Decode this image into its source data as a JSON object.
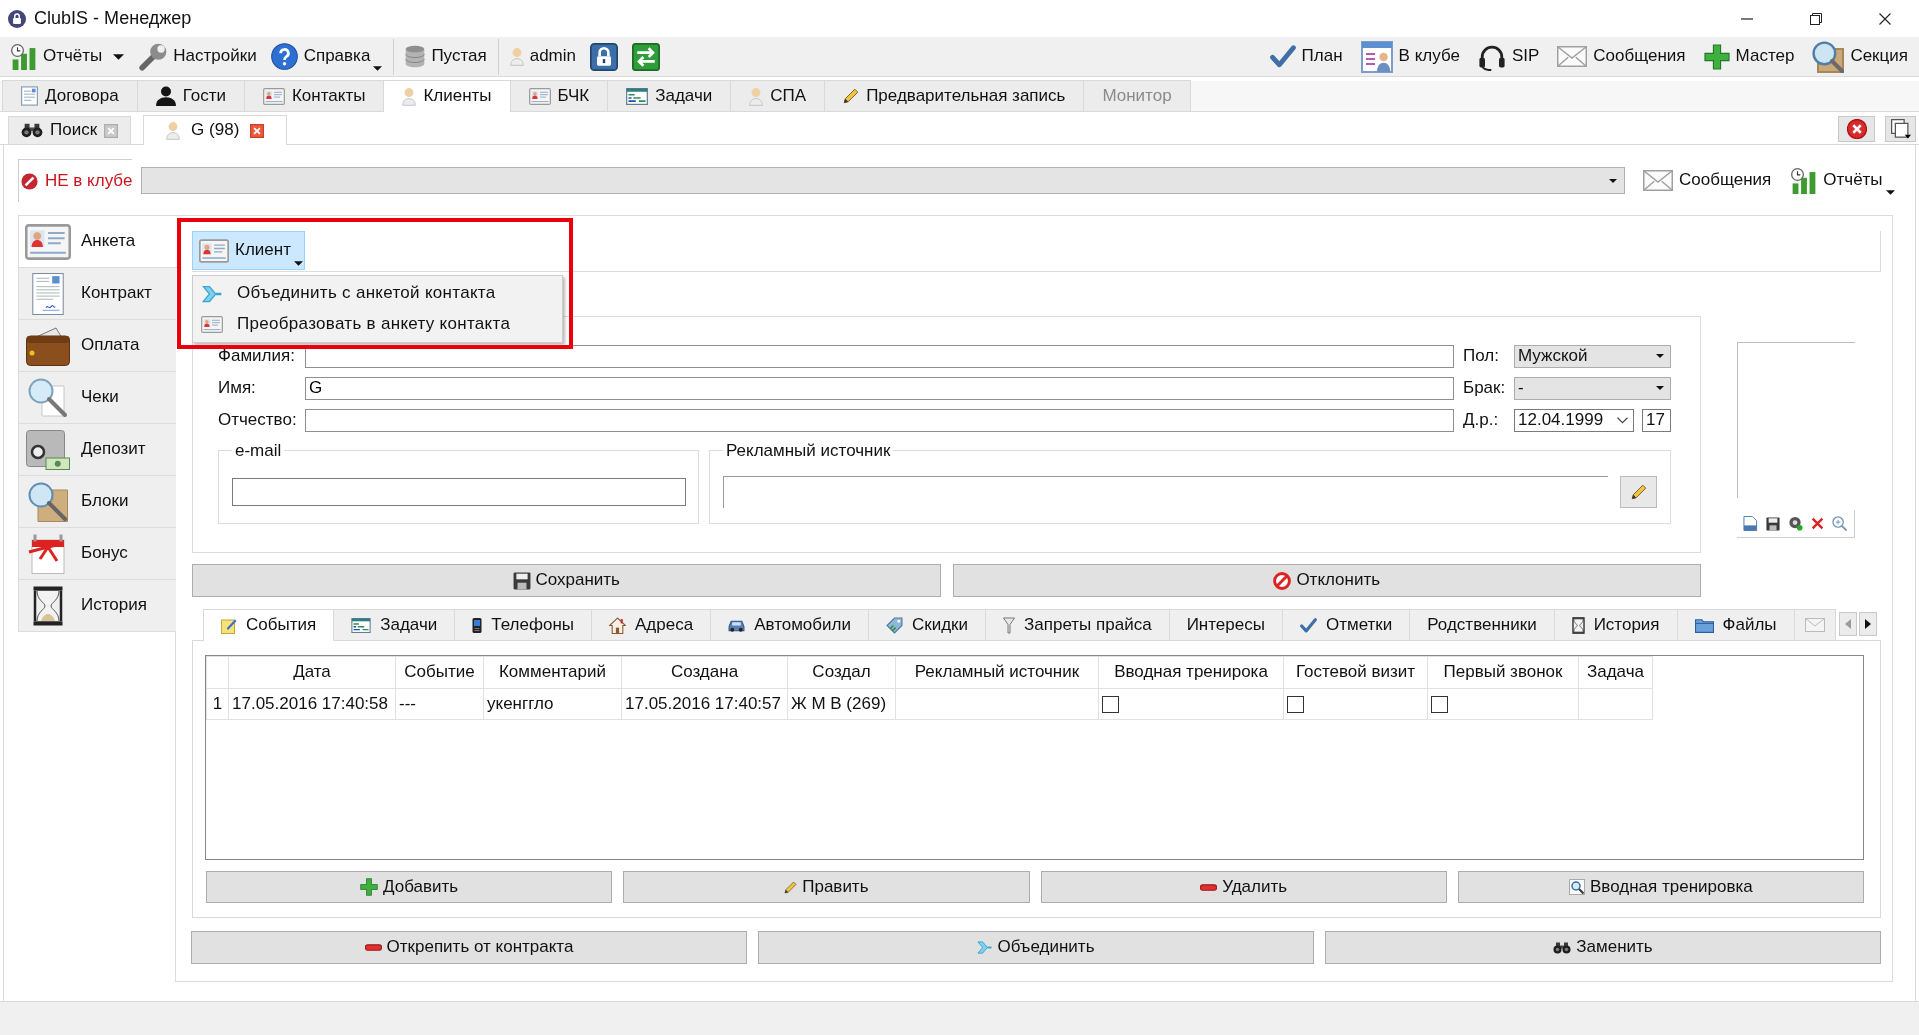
{
  "window": {
    "title": "ClubIS - Менеджер"
  },
  "toolbar": {
    "groups": [
      [
        {
          "kind": "split",
          "label": "Отчёты"
        },
        {
          "kind": "plain",
          "label": "Настройки"
        },
        {
          "kind": "menu",
          "label": "Справка"
        }
      ],
      [
        {
          "kind": "plain",
          "label": "Пустая"
        }
      ],
      [
        {
          "kind": "plain",
          "label": "admin"
        },
        {
          "kind": "icon"
        },
        {
          "kind": "icon"
        }
      ]
    ],
    "right": [
      {
        "kind": "plain",
        "label": "План"
      },
      {
        "kind": "plain",
        "label": "В клубе"
      },
      {
        "kind": "plain",
        "label": "SIP"
      },
      {
        "kind": "plain",
        "label": "Сообщения"
      },
      {
        "kind": "plain",
        "label": "Мастер"
      },
      {
        "kind": "plain",
        "label": "Секция"
      }
    ]
  },
  "main_tabs": [
    {
      "label": "Договора",
      "selected": false,
      "disabled": false
    },
    {
      "label": "Гости",
      "selected": false,
      "disabled": false
    },
    {
      "label": "Контакты",
      "selected": false,
      "disabled": false
    },
    {
      "label": "Клиенты",
      "selected": true,
      "disabled": false
    },
    {
      "label": "БЧК",
      "selected": false,
      "disabled": false
    },
    {
      "label": "Задачи",
      "selected": false,
      "disabled": false
    },
    {
      "label": "СПА",
      "selected": false,
      "disabled": false
    },
    {
      "label": "Предварительная запись",
      "selected": false,
      "disabled": false
    },
    {
      "label": "Монитор",
      "selected": false,
      "disabled": true
    }
  ],
  "document_tabs": [
    {
      "label": "Поиск",
      "selected": false
    },
    {
      "label": "G (98)",
      "selected": true
    }
  ],
  "presence": {
    "label": "НЕ в клубе",
    "in_club": false
  },
  "header_buttons": [
    {
      "kind": "plain",
      "label": "Сообщения"
    },
    {
      "kind": "menu",
      "label": "Отчёты"
    }
  ],
  "sidebar": [
    {
      "label": "Анкета",
      "selected": true
    },
    {
      "label": "Контракт",
      "selected": false
    },
    {
      "label": "Оплата",
      "selected": false
    },
    {
      "label": "Чеки",
      "selected": false
    },
    {
      "label": "Депозит",
      "selected": false
    },
    {
      "label": "Блоки",
      "selected": false
    },
    {
      "label": "Бонус",
      "selected": false
    },
    {
      "label": "История",
      "selected": false
    }
  ],
  "client_menu": {
    "button": "Клиент",
    "expanded": true,
    "items": [
      "Объединить с анкетой контакта",
      "Преобразовать в анкету контакта"
    ]
  },
  "person": {
    "fields": [
      {
        "label": "Фамилия:"
      },
      {
        "label": "Имя:",
        "value": "G"
      },
      {
        "label": "Отчество:"
      }
    ],
    "attributes": [
      {
        "kind": "select",
        "label": "Пол:",
        "value": "Мужской"
      },
      {
        "kind": "select",
        "label": "Брак:",
        "value": "-"
      },
      {
        "kind": "date",
        "label": "Д.р.:",
        "value": "12.04.1999",
        "age": "17"
      }
    ],
    "email": {
      "title": "e-mail"
    },
    "ad_source": {
      "title": "Рекламный источник"
    }
  },
  "form_buttons": [
    "Сохранить",
    "Отклонить"
  ],
  "detail_tabs": [
    {
      "label": "События",
      "selected": true
    },
    {
      "label": "Задачи",
      "selected": false
    },
    {
      "label": "Телефоны",
      "selected": false
    },
    {
      "label": "Адреса",
      "selected": false
    },
    {
      "label": "Автомобили",
      "selected": false
    },
    {
      "label": "Скидки",
      "selected": false
    },
    {
      "label": "Запреты прайса",
      "selected": false
    },
    {
      "label": "Интересы",
      "selected": false
    },
    {
      "label": "Отметки",
      "selected": false
    },
    {
      "label": "Родственники",
      "selected": false
    },
    {
      "label": "История",
      "selected": false
    },
    {
      "label": "Файлы",
      "selected": false
    },
    {
      "selected": false
    }
  ],
  "events_table": {
    "columns": [
      "Дата",
      "Событие",
      "Комментарий",
      "Создана",
      "Создал",
      "Рекламный источник",
      "Вводная тренирока",
      "Гостевой визит",
      "Первый звонок",
      "Задача"
    ],
    "rows": [
      {
        "number": "1",
        "cells": [
          "17.05.2016 17:40:58",
          "---",
          "укенггло",
          "17.05.2016 17:40:57",
          "Ж М В (269)",
          null,
          {
            "checked": false
          },
          {
            "checked": false
          },
          {
            "checked": false
          },
          null
        ]
      }
    ]
  },
  "table_buttons": [
    "Добавить",
    "Править",
    "Удалить",
    "Вводная тренировка"
  ],
  "bottom_buttons": [
    "Открепить от контракта",
    "Объединить",
    "Заменить"
  ]
}
